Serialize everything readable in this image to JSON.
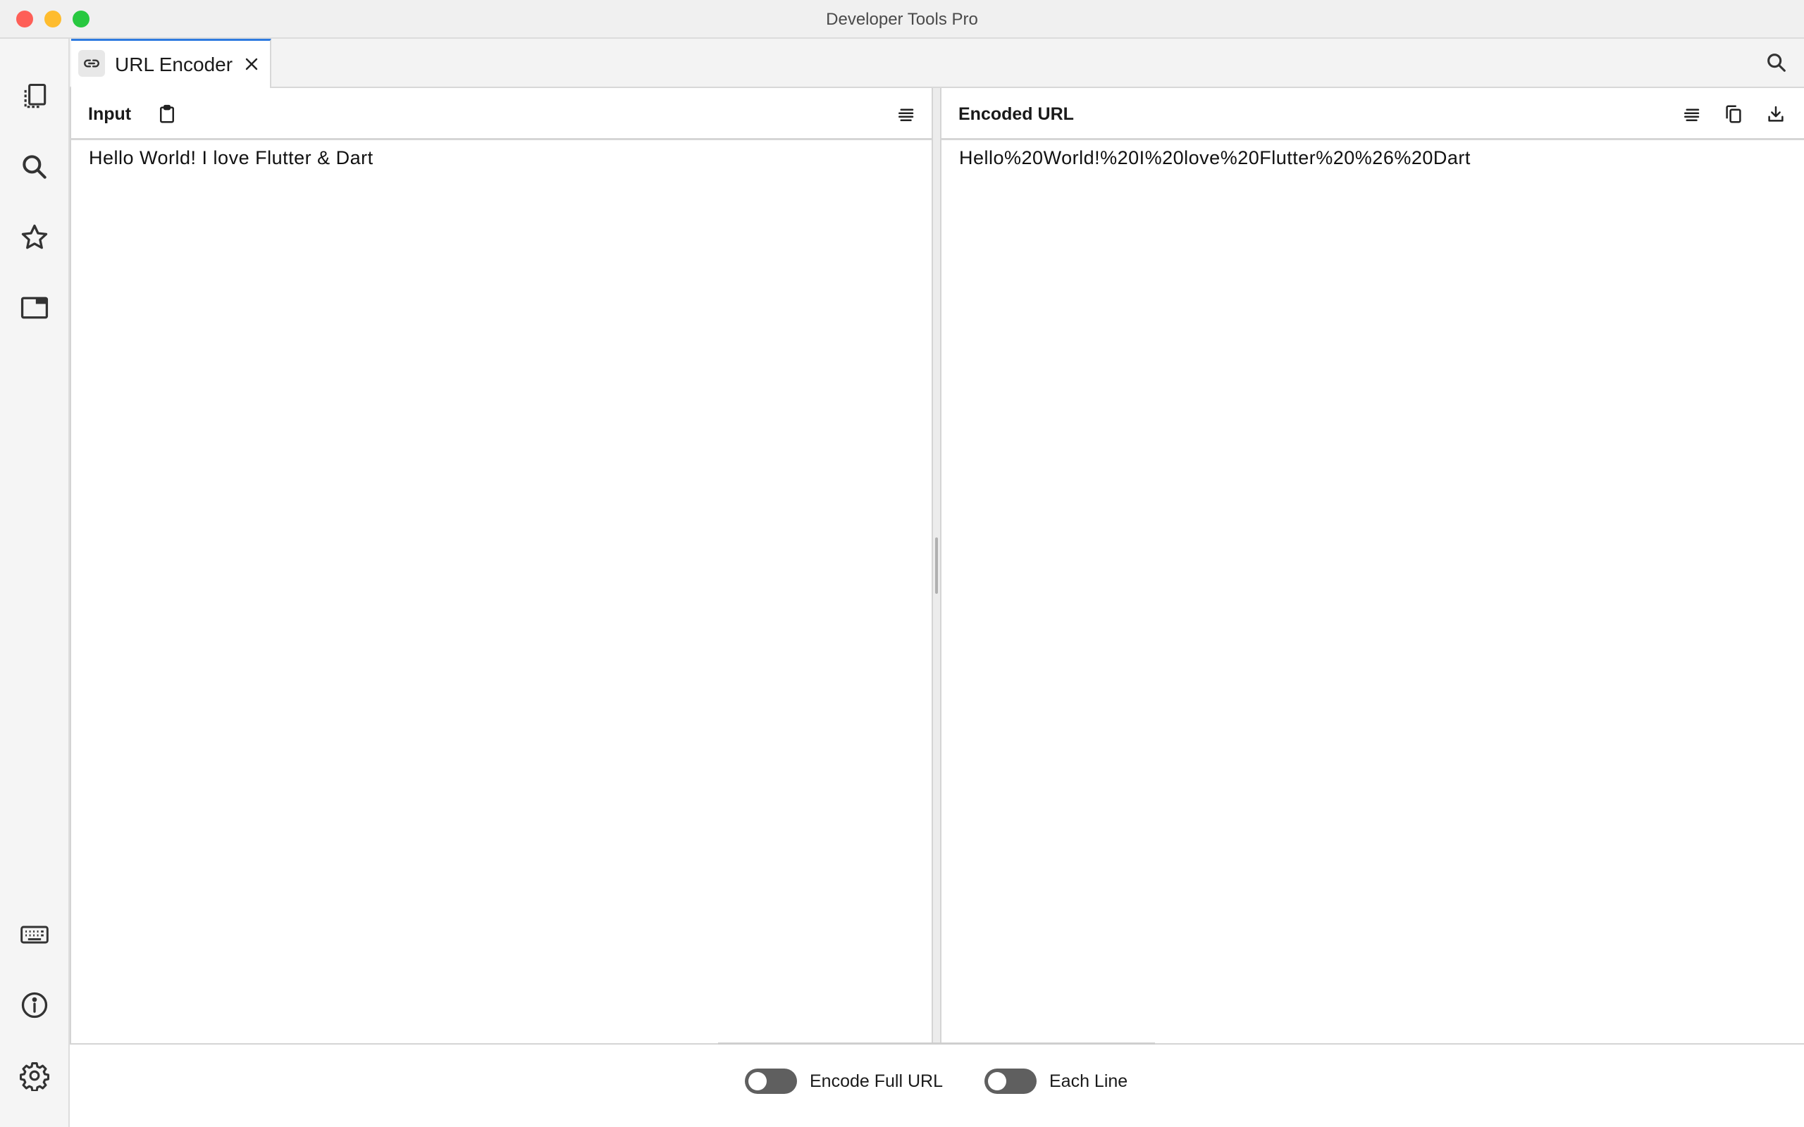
{
  "window": {
    "title": "Developer Tools Pro"
  },
  "sidebar": {
    "top_items": [
      {
        "icon": "pages-icon"
      },
      {
        "icon": "search-icon"
      },
      {
        "icon": "star-icon"
      },
      {
        "icon": "window-icon"
      }
    ],
    "bottom_items": [
      {
        "icon": "keyboard-icon"
      },
      {
        "icon": "info-icon"
      },
      {
        "icon": "gear-icon"
      }
    ]
  },
  "tabs": [
    {
      "label": "URL Encoder",
      "icon": "link-icon",
      "active": true
    }
  ],
  "input_panel": {
    "title": "Input",
    "text": "Hello World! I love Flutter & Dart"
  },
  "output_panel": {
    "title": "Encoded URL",
    "text": "Hello%20World!%20I%20love%20Flutter%20%26%20Dart"
  },
  "options": {
    "encode_full_url": {
      "label": "Encode Full URL",
      "enabled": false
    },
    "each_line": {
      "label": "Each Line",
      "enabled": false
    }
  },
  "colors": {
    "accent": "#2f7be0",
    "toggle_off": "#5f5f5f",
    "close": "#fe5f57",
    "minimize": "#febc2e",
    "maximize": "#28c840"
  }
}
